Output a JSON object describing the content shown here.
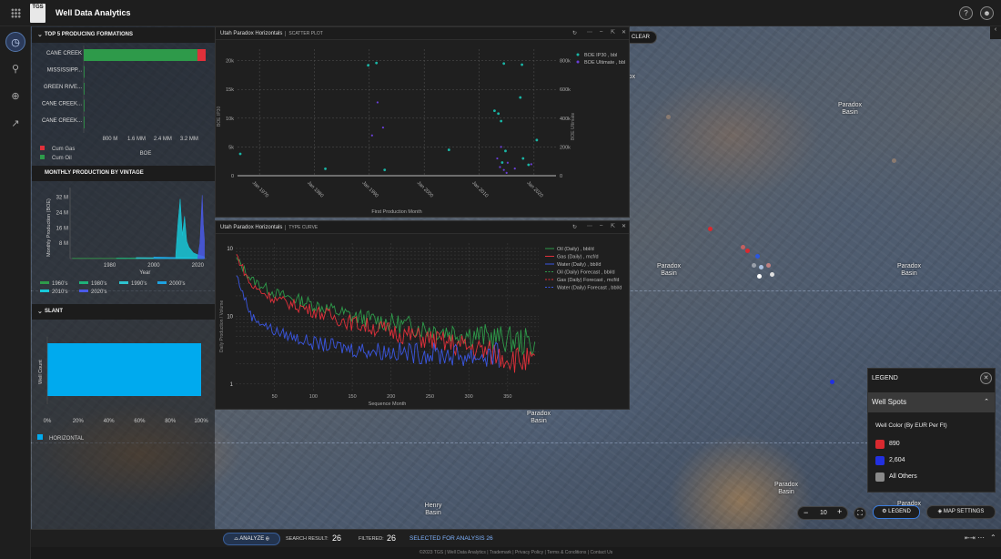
{
  "app": {
    "logo": "TGS",
    "title": "Well Data Analytics"
  },
  "map": {
    "clear_label": "CLEAR",
    "labels": [
      {
        "text": "Paradox\nBasin"
      },
      {
        "text": "Paradox\nBasin"
      },
      {
        "text": "Paradox\nBasin"
      },
      {
        "text": "Paradox\nBasin"
      },
      {
        "text": "Paradox\nBasin"
      },
      {
        "text": "Henry\nBasin"
      },
      {
        "text": "Paradox\nBasin"
      },
      {
        "text": "Paradox"
      }
    ],
    "zoom": "10",
    "legend_button": "LEGEND",
    "map_settings_button": "MAP SETTINGS"
  },
  "formations": {
    "title": "TOP 5 PRODUCING FORMATIONS",
    "chart_data": {
      "type": "bar",
      "orientation": "horizontal",
      "stacked": true,
      "categories": [
        "CANE CREEK",
        "MISSISSIPP...",
        "GREEN RIVE...",
        "CANE CREEK...",
        "CANE CREEK..."
      ],
      "series": [
        {
          "name": "Cum Oil",
          "color": "#2e9a4a",
          "values": [
            3450000,
            8000,
            6000,
            3000,
            2000
          ]
        },
        {
          "name": "Cum Gas",
          "color": "#e0303a",
          "values": [
            250000,
            0,
            0,
            0,
            0
          ]
        }
      ],
      "xticks": [
        "800 M",
        "1.6 MM",
        "2.4 MM",
        "3.2 MM"
      ],
      "xlabel": "BOE",
      "xlim": [
        0,
        3700000
      ]
    }
  },
  "vintage": {
    "title": "MONTHLY PRODUCTION BY VINTAGE",
    "chart_data": {
      "type": "area",
      "ylabel": "Monthly Production (BOE)",
      "xlabel": "Year",
      "yticks": [
        "8 M",
        "16 M",
        "24 M",
        "32 M"
      ],
      "xticks": [
        "1980",
        "2000",
        "2020"
      ],
      "xlim": [
        1962,
        2024
      ],
      "ylim": [
        0,
        37000000
      ],
      "series": [
        {
          "name": "1960's",
          "color": "#2e9a4a",
          "points": [
            [
              1963,
              200000
            ],
            [
              2023,
              100000
            ]
          ]
        },
        {
          "name": "1980's",
          "color": "#1fb27a",
          "points": [
            [
              1983,
              300000
            ],
            [
              2023,
              200000
            ]
          ]
        },
        {
          "name": "1990's",
          "color": "#2ec4d0",
          "points": [
            [
              1992,
              500000
            ],
            [
              2023,
              300000
            ]
          ]
        },
        {
          "name": "2000's",
          "color": "#1ea2e0",
          "points": [
            [
              2000,
              800000
            ],
            [
              2023,
              400000
            ]
          ]
        },
        {
          "name": "2010's",
          "color": "#18c8d8",
          "points": [
            [
              2010,
              2000000
            ],
            [
              2011,
              18000000
            ],
            [
              2012,
              31000000
            ],
            [
              2013,
              12000000
            ],
            [
              2014,
              22000000
            ],
            [
              2015,
              9000000
            ],
            [
              2016,
              6000000
            ],
            [
              2018,
              3000000
            ],
            [
              2020,
              2000000
            ],
            [
              2023,
              1000000
            ]
          ]
        },
        {
          "name": "2020's",
          "color": "#4a5ae8",
          "points": [
            [
              2020,
              500000
            ],
            [
              2021,
              8000000
            ],
            [
              2022,
              33000000
            ],
            [
              2022.5,
              18000000
            ],
            [
              2023,
              10000000
            ]
          ]
        }
      ]
    }
  },
  "slant": {
    "title": "SLANT",
    "chart_data": {
      "type": "bar",
      "orientation": "horizontal",
      "categories": [
        "HORIZONTAL"
      ],
      "values": [
        100
      ],
      "ylabel": "Well Count",
      "xticks": [
        "0%",
        "20%",
        "40%",
        "60%",
        "80%",
        "100%"
      ],
      "xlim": [
        0,
        100
      ],
      "color": "#00aaee"
    },
    "legend": "HORIZONTAL"
  },
  "scatter_window": {
    "title": "Utah Paradox Horizontals",
    "subtitle": "SCATTER PLOT",
    "chart_data": {
      "type": "scatter",
      "xlabel": "First Production Month",
      "ylabel_left": "BOE IP30",
      "ylabel_right": "BOE Ultimate",
      "xticks": [
        "Jan 1970",
        "Jan 1980",
        "Jan 1990",
        "Jan 2000",
        "Jan 2010",
        "Jan 2020"
      ],
      "yticks_left": [
        "0",
        "5k",
        "10k",
        "15k",
        "20k"
      ],
      "yticks_right": [
        "0",
        "200k",
        "400k",
        "600k",
        "800k"
      ],
      "xlim": [
        1966,
        2024
      ],
      "ylim_left": [
        0,
        22000
      ],
      "ylim_right": [
        0,
        880000
      ],
      "series": [
        {
          "name": "BOE IP30 , bbl",
          "color": "#19b6a6",
          "points": [
            [
              1966.5,
              3800
            ],
            [
              1982,
              1200
            ],
            [
              1989.8,
              19200
            ],
            [
              1991.3,
              19600
            ],
            [
              1992.8,
              1000
            ],
            [
              2004.5,
              4500
            ],
            [
              2012.8,
              11300
            ],
            [
              2013.5,
              10800
            ],
            [
              2014,
              9500
            ],
            [
              2014.5,
              19500
            ],
            [
              2014.8,
              4300
            ],
            [
              2017.5,
              13600
            ],
            [
              2017.8,
              19300
            ],
            [
              2018,
              3000
            ],
            [
              2020.5,
              6200
            ],
            [
              2019,
              1900
            ],
            [
              2014.2,
              2300
            ]
          ]
        },
        {
          "name": "BOE Ultimate , bbl",
          "color": "#6a3fd8",
          "points": [
            [
              1990.5,
              280000
            ],
            [
              1992.5,
              335000
            ],
            [
              1991.5,
              510000
            ],
            [
              2013.3,
              120000
            ],
            [
              2014,
              200000
            ],
            [
              2014.5,
              40000
            ],
            [
              2015.2,
              90000
            ],
            [
              2013.8,
              60000
            ],
            [
              2016.5,
              50000
            ],
            [
              2019.5,
              80000
            ],
            [
              2015,
              20000
            ]
          ]
        }
      ]
    }
  },
  "type_window": {
    "title": "Utah Paradox Horizontals",
    "subtitle": "TYPE CURVE",
    "chart_data": {
      "type": "line",
      "xlabel": "Sequence Month",
      "ylabel": "Daily Production / Volume",
      "xticks": [
        "50",
        "100",
        "150",
        "200",
        "250",
        "300",
        "350"
      ],
      "yticks": [
        "10",
        "10",
        "1"
      ],
      "xlim": [
        0,
        390
      ],
      "log_scale_y": true,
      "series": [
        {
          "name": "Oil (Daily) , bbl/d",
          "color": "#2e9a4a",
          "points": [
            [
              1,
              70
            ],
            [
              20,
              35
            ],
            [
              50,
              22
            ],
            [
              100,
              15
            ],
            [
              150,
              10
            ],
            [
              200,
              8
            ],
            [
              250,
              6.5
            ],
            [
              300,
              5.5
            ],
            [
              350,
              4.5
            ],
            [
              385,
              4
            ]
          ]
        },
        {
          "name": "Gas (Daily) , mcf/d",
          "color": "#e0303a",
          "points": [
            [
              1,
              80
            ],
            [
              20,
              28
            ],
            [
              50,
              18
            ],
            [
              100,
              12
            ],
            [
              150,
              8
            ],
            [
              200,
              6
            ],
            [
              250,
              4.5
            ],
            [
              300,
              3.5
            ],
            [
              350,
              2.5
            ],
            [
              385,
              2
            ]
          ]
        },
        {
          "name": "Water (Daily) , bbl/d",
          "color": "#3a56e0",
          "points": [
            [
              1,
              40
            ],
            [
              20,
              10
            ],
            [
              50,
              6
            ],
            [
              100,
              4
            ],
            [
              150,
              3.3
            ],
            [
              200,
              3
            ],
            [
              250,
              2.8
            ],
            [
              300,
              2.6
            ],
            [
              340,
              2.6
            ]
          ]
        },
        {
          "name": "Oil (Daily) Forecast , bbl/d",
          "color": "#2e9a4a",
          "dashed": true,
          "points": []
        },
        {
          "name": "Gas (Daily) Forecast , mcf/d",
          "color": "#e0303a",
          "dashed": true,
          "points": []
        },
        {
          "name": "Water (Daily) Forecast , bbl/d",
          "color": "#3a56e0",
          "dashed": true,
          "points": []
        }
      ]
    }
  },
  "legend": {
    "title": "LEGEND",
    "section": "Well Spots",
    "subtitle": "Well Color (By EUR Per Ft)",
    "items": [
      {
        "label": "890",
        "color": "#d8292f"
      },
      {
        "label": "2,604",
        "color": "#2230e0"
      },
      {
        "label": "All Others",
        "color": "#8a8a8a"
      }
    ]
  },
  "bottom": {
    "analyze": "ANALYZE",
    "search_label": "SEARCH RESULT:",
    "search_value": "26",
    "filtered_label": "FILTERED:",
    "filtered_value": "26",
    "selected": "SELECTED FOR ANALYSIS 26"
  },
  "footer": "©2023 TGS | Well Data Analytics | Trademark | Privacy Policy | Terms & Conditions | Contact Us"
}
